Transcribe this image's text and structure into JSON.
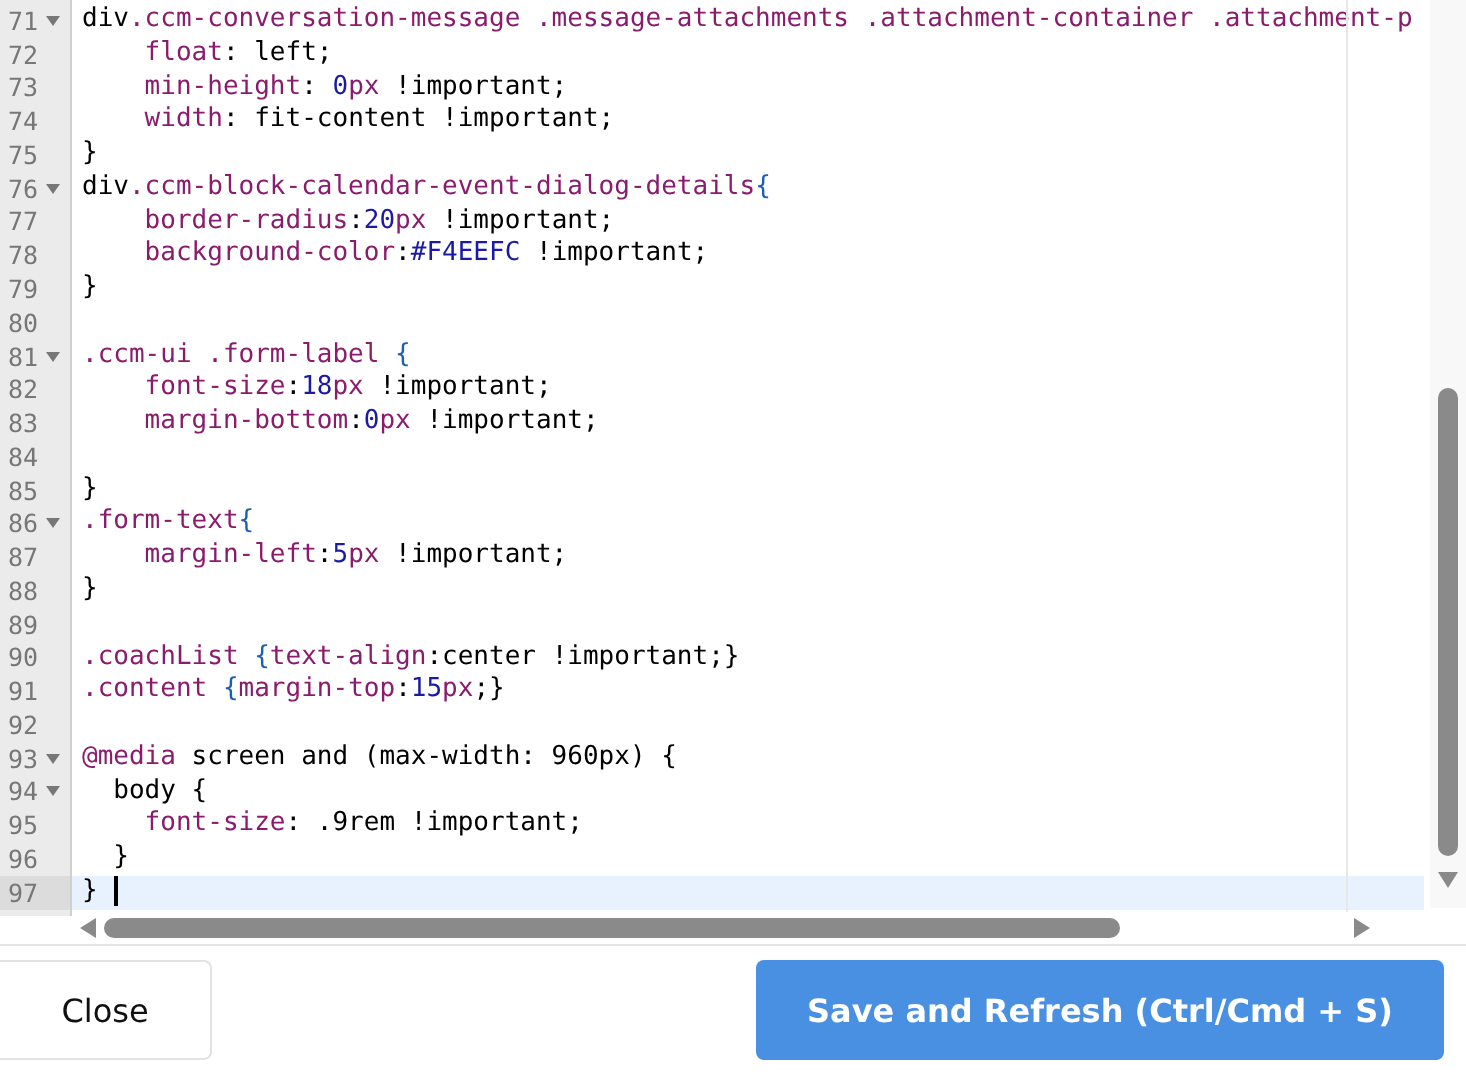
{
  "editor": {
    "lines": [
      {
        "number": "71",
        "fold": true,
        "active": false,
        "tokens": [
          {
            "kind": "tag",
            "text": "div"
          },
          {
            "kind": "sel",
            "text": ".ccm-conversation-message .message-attachments .attachment-container .attachment-p"
          }
        ]
      },
      {
        "number": "72",
        "fold": false,
        "active": false,
        "tokens": [
          {
            "kind": "prop",
            "text": "    float"
          },
          {
            "kind": "plain",
            "text": ": left;"
          }
        ]
      },
      {
        "number": "73",
        "fold": false,
        "active": false,
        "tokens": [
          {
            "kind": "prop",
            "text": "    min-height"
          },
          {
            "kind": "plain",
            "text": ": "
          },
          {
            "kind": "num",
            "text": "0"
          },
          {
            "kind": "prop",
            "text": "px"
          },
          {
            "kind": "plain",
            "text": " !important;"
          }
        ]
      },
      {
        "number": "74",
        "fold": false,
        "active": false,
        "tokens": [
          {
            "kind": "prop",
            "text": "    width"
          },
          {
            "kind": "plain",
            "text": ": fit-content !important;"
          }
        ]
      },
      {
        "number": "75",
        "fold": false,
        "active": false,
        "tokens": [
          {
            "kind": "plain",
            "text": "}"
          }
        ]
      },
      {
        "number": "76",
        "fold": true,
        "active": false,
        "tokens": [
          {
            "kind": "tag",
            "text": "div"
          },
          {
            "kind": "sel",
            "text": ".ccm-block-calendar-event-dialog-details"
          },
          {
            "kind": "brace",
            "text": "{"
          }
        ]
      },
      {
        "number": "77",
        "fold": false,
        "active": false,
        "tokens": [
          {
            "kind": "prop",
            "text": "    border-radius"
          },
          {
            "kind": "plain",
            "text": ":"
          },
          {
            "kind": "num",
            "text": "20"
          },
          {
            "kind": "prop",
            "text": "px"
          },
          {
            "kind": "plain",
            "text": " !important;"
          }
        ]
      },
      {
        "number": "78",
        "fold": false,
        "active": false,
        "tokens": [
          {
            "kind": "prop",
            "text": "    background-color"
          },
          {
            "kind": "plain",
            "text": ":"
          },
          {
            "kind": "num",
            "text": "#F4EEFC"
          },
          {
            "kind": "plain",
            "text": " !important;"
          }
        ]
      },
      {
        "number": "79",
        "fold": false,
        "active": false,
        "tokens": [
          {
            "kind": "plain",
            "text": "}"
          }
        ]
      },
      {
        "number": "80",
        "fold": false,
        "active": false
      },
      {
        "number": "81",
        "fold": true,
        "active": false,
        "tokens": [
          {
            "kind": "sel",
            "text": ".ccm-ui .form-label "
          },
          {
            "kind": "brace",
            "text": "{"
          }
        ]
      },
      {
        "number": "82",
        "fold": false,
        "active": false,
        "tokens": [
          {
            "kind": "prop",
            "text": "    font-size"
          },
          {
            "kind": "plain",
            "text": ":"
          },
          {
            "kind": "num",
            "text": "18"
          },
          {
            "kind": "prop",
            "text": "px"
          },
          {
            "kind": "plain",
            "text": " !important;"
          }
        ]
      },
      {
        "number": "83",
        "fold": false,
        "active": false,
        "tokens": [
          {
            "kind": "prop",
            "text": "    margin-bottom"
          },
          {
            "kind": "plain",
            "text": ":"
          },
          {
            "kind": "num",
            "text": "0"
          },
          {
            "kind": "prop",
            "text": "px"
          },
          {
            "kind": "plain",
            "text": " !important;"
          }
        ]
      },
      {
        "number": "84",
        "fold": false,
        "active": false
      },
      {
        "number": "85",
        "fold": false,
        "active": false,
        "tokens": [
          {
            "kind": "plain",
            "text": "}"
          }
        ]
      },
      {
        "number": "86",
        "fold": true,
        "active": false,
        "tokens": [
          {
            "kind": "sel",
            "text": ".form-text"
          },
          {
            "kind": "brace",
            "text": "{"
          }
        ]
      },
      {
        "number": "87",
        "fold": false,
        "active": false,
        "tokens": [
          {
            "kind": "prop",
            "text": "    margin-left"
          },
          {
            "kind": "plain",
            "text": ":"
          },
          {
            "kind": "num",
            "text": "5"
          },
          {
            "kind": "prop",
            "text": "px"
          },
          {
            "kind": "plain",
            "text": " !important;"
          }
        ]
      },
      {
        "number": "88",
        "fold": false,
        "active": false,
        "tokens": [
          {
            "kind": "plain",
            "text": "}"
          }
        ]
      },
      {
        "number": "89",
        "fold": false,
        "active": false
      },
      {
        "number": "90",
        "fold": false,
        "active": false,
        "tokens": [
          {
            "kind": "sel",
            "text": ".coachList "
          },
          {
            "kind": "brace",
            "text": "{"
          },
          {
            "kind": "prop",
            "text": "text-align"
          },
          {
            "kind": "plain",
            "text": ":center !important;}"
          }
        ]
      },
      {
        "number": "91",
        "fold": false,
        "active": false,
        "tokens": [
          {
            "kind": "sel",
            "text": ".content "
          },
          {
            "kind": "brace",
            "text": "{"
          },
          {
            "kind": "prop",
            "text": "margin-top"
          },
          {
            "kind": "plain",
            "text": ":"
          },
          {
            "kind": "num",
            "text": "15"
          },
          {
            "kind": "prop",
            "text": "px"
          },
          {
            "kind": "plain",
            "text": ";}"
          }
        ]
      },
      {
        "number": "92",
        "fold": false,
        "active": false
      },
      {
        "number": "93",
        "fold": true,
        "active": false,
        "tokens": [
          {
            "kind": "sel",
            "text": "@media"
          },
          {
            "kind": "plain",
            "text": " screen and (max-width: 960px) {"
          }
        ]
      },
      {
        "number": "94",
        "fold": true,
        "active": false,
        "tokens": [
          {
            "kind": "plain",
            "text": "  body {"
          }
        ]
      },
      {
        "number": "95",
        "fold": false,
        "active": false,
        "tokens": [
          {
            "kind": "prop",
            "text": "    font-size"
          },
          {
            "kind": "plain",
            "text": ": .9rem !important;"
          }
        ]
      },
      {
        "number": "96",
        "fold": false,
        "active": false,
        "tokens": [
          {
            "kind": "plain",
            "text": "  }"
          }
        ]
      },
      {
        "number": "97",
        "fold": false,
        "active": true,
        "tokens": [
          {
            "kind": "plain",
            "text": "} "
          }
        ]
      }
    ]
  },
  "buttons": [
    {
      "label": "Close",
      "kind": "secondary"
    },
    {
      "label": "Save and Refresh (Ctrl/Cmd + S)",
      "kind": "primary"
    }
  ]
}
